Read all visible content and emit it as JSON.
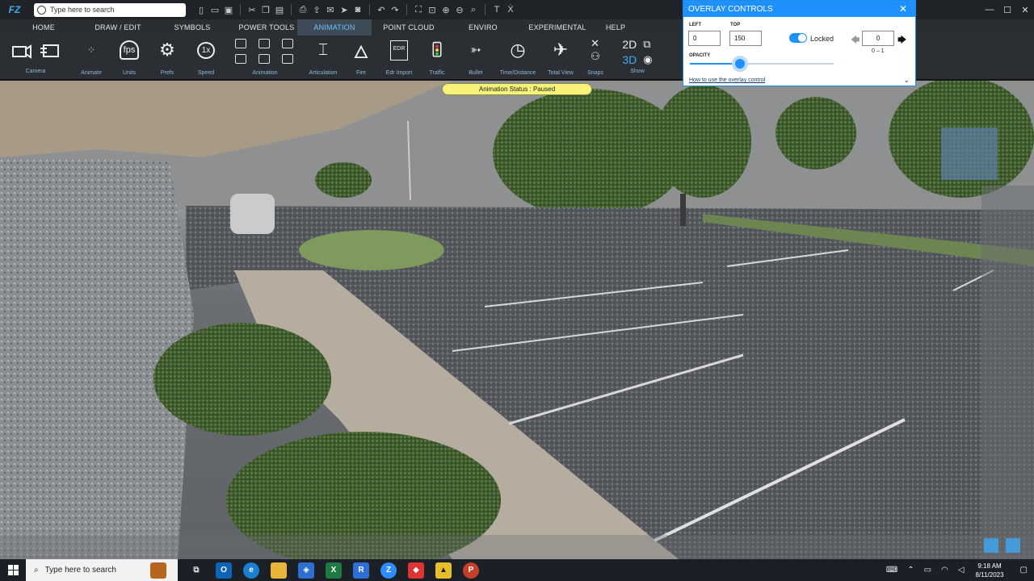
{
  "titlebar": {
    "logo": "FZ",
    "search_placeholder": "Type here to search"
  },
  "menu": {
    "tabs": [
      "HOME",
      "DRAW / EDIT",
      "SYMBOLS",
      "POWER TOOLS",
      "ANIMATION",
      "POINT CLOUD",
      "ENVIRO",
      "EXPERIMENTAL",
      "HELP"
    ],
    "active": "ANIMATION"
  },
  "ribbon": {
    "groups": {
      "camera": "Camera",
      "animate": "Animate",
      "units": "Units",
      "units_icon": "fps",
      "prefs": "Prefs",
      "speed": "Speed",
      "speed_icon": "1x",
      "animation": "Animation",
      "articulation": "Articulation",
      "fire": "Fire",
      "edr_import": "Edr Import",
      "edr_icon": "EDR",
      "traffic": "Traffic",
      "bullet": "Bullet",
      "time_distance": "Time/Distance",
      "total_view": "Total View",
      "snaps": "Snaps",
      "show": "Show",
      "show_2d": "2D",
      "show_3d": "3D"
    }
  },
  "status": {
    "text": "Animation Status : Paused"
  },
  "overlay": {
    "title": "OVERLAY CONTROLS",
    "left_label": "LEFT",
    "left_value": "0",
    "top_label": "TOP",
    "top_value": "150",
    "locked_label": "Locked",
    "step_value": "0",
    "range_label": "0 – 1",
    "opacity_label": "OPACITY",
    "opacity": 0.35,
    "help_link": "How to use the overlay control"
  },
  "taskbar": {
    "search_placeholder": "Type here to search",
    "time": "9:18 AM",
    "date": "8/11/2023"
  },
  "colors": {
    "accent": "#1e90ff",
    "active_tab": "#6ec4ff",
    "status_pill": "#f6f27a"
  }
}
